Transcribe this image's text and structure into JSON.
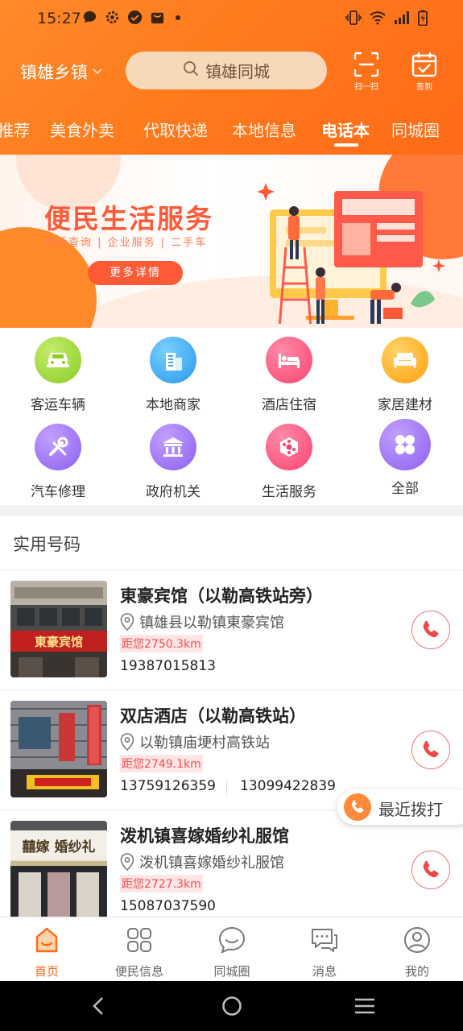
{
  "status_bar": {
    "time": "15:27",
    "left_icons": [
      "chat-bubble-icon",
      "gear-icon",
      "check-circle-icon",
      "bag-icon"
    ],
    "right_icons": [
      "vibrate-icon",
      "wifi-icon",
      "signal-icon",
      "battery-charging-icon"
    ]
  },
  "header": {
    "location": "镇雄乡镇",
    "search_placeholder": "镇雄同城",
    "scan_label": "扫一扫",
    "checkin_label": "签到"
  },
  "tabs": [
    {
      "label": "推荐",
      "active": false
    },
    {
      "label": "美食外卖",
      "active": false
    },
    {
      "label": "代取快递",
      "active": false
    },
    {
      "label": "本地信息",
      "active": false
    },
    {
      "label": "电话本",
      "active": true
    },
    {
      "label": "同城圈",
      "active": false
    }
  ],
  "banner": {
    "title": "便民生活服务",
    "subtitle": "电话查询 | 企业服务 | 二手车",
    "button": "更多详情"
  },
  "categories": [
    {
      "label": "客运车辆",
      "icon": "car-icon",
      "color": "#9bd63a"
    },
    {
      "label": "本地商家",
      "icon": "building-icon",
      "color": "#3aa9ef"
    },
    {
      "label": "酒店住宿",
      "icon": "bed-icon",
      "color": "#ff5b86"
    },
    {
      "label": "家居建材",
      "icon": "sofa-icon",
      "color": "#ffb224"
    },
    {
      "label": "汽车修理",
      "icon": "wrench-icon",
      "color": "#9b6bf0"
    },
    {
      "label": "政府机关",
      "icon": "government-icon",
      "color": "#9b6bf0"
    },
    {
      "label": "生活服务",
      "icon": "service-cube-icon",
      "color": "#ff5b86"
    },
    {
      "label": "全部",
      "icon": "all-grid-icon",
      "color": "#9b6bf0"
    }
  ],
  "section_title": "实用号码",
  "listings": [
    {
      "name": "東豪宾馆（以勒高铁站旁）",
      "address": "镇雄县以勒镇東豪宾馆",
      "distance": "距您2750.3km",
      "phones": [
        "19387015813"
      ],
      "thumb_sign": "東豪宾馆"
    },
    {
      "name": "双店酒店（以勒高铁站）",
      "address": "以勒镇庙埂村高铁站",
      "distance": "距您2749.1km",
      "phones": [
        "13759126359",
        "13099422839"
      ],
      "thumb_sign": ""
    },
    {
      "name": "泼机镇喜嫁婚纱礼服馆",
      "address": "泼机镇喜嫁婚纱礼服馆",
      "distance": "距您2727.3km",
      "phones": [
        "15087037590"
      ],
      "thumb_sign": "囍嫁 婚纱礼"
    }
  ],
  "recent_call": "最近拨打",
  "bottom_nav": [
    {
      "label": "首页",
      "icon": "home-icon",
      "active": true
    },
    {
      "label": "便民信息",
      "icon": "grid-icon",
      "active": false
    },
    {
      "label": "同城圈",
      "icon": "smile-chat-icon",
      "active": false
    },
    {
      "label": "消息",
      "icon": "message-icon",
      "active": false
    },
    {
      "label": "我的",
      "icon": "profile-icon",
      "active": false
    }
  ],
  "colors": {
    "brand_orange": "#ff7a1c",
    "call_red": "#f04848",
    "distance_red": "#ff4b4b"
  }
}
